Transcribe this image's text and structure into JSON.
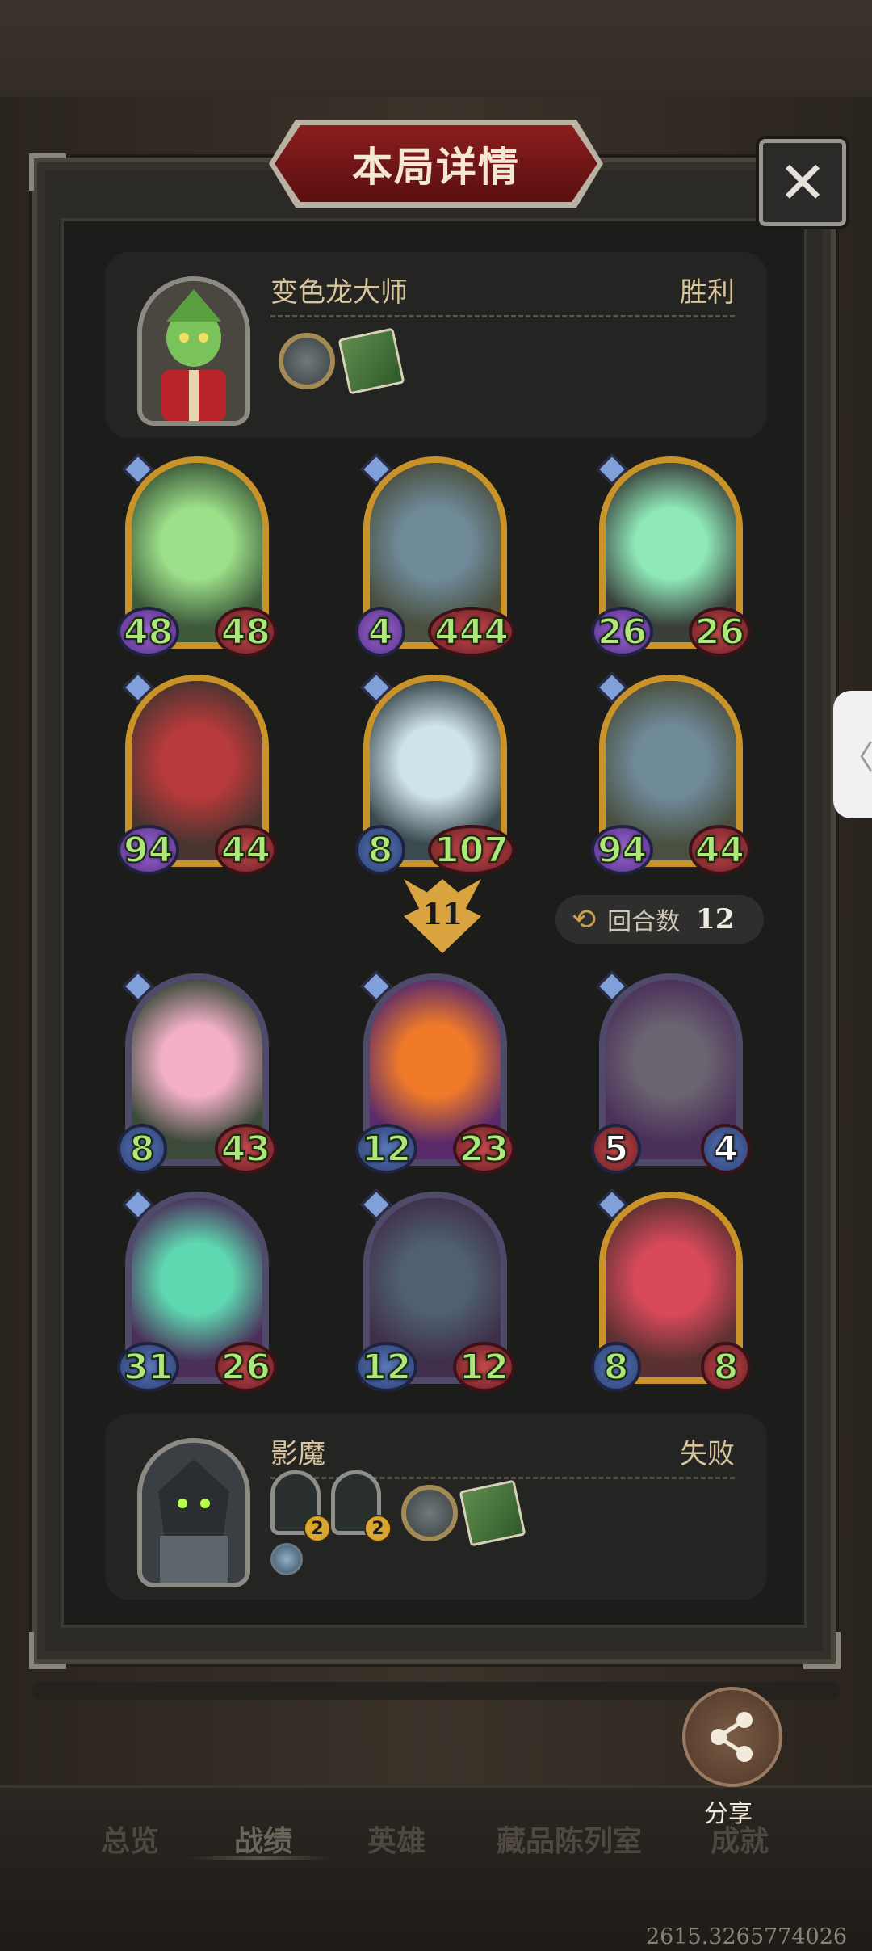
{
  "title": "本局详情",
  "close_label": "✕",
  "side_tab_glyph": "〈",
  "player1": {
    "name": "变色龙大师",
    "result": "胜利",
    "items": [
      "coin-relic",
      "green-book"
    ]
  },
  "player2": {
    "name": "影魔",
    "result": "失败",
    "items": [
      "hero-card-1",
      "hero-card-2",
      "coin-relic",
      "green-book",
      "blue-emblem"
    ],
    "stack_counts": [
      "2",
      "2"
    ]
  },
  "player1_board": [
    {
      "atk": "48",
      "hp": "48",
      "atk_type": "poison",
      "frame": "gold",
      "art": "green-sword-spirit"
    },
    {
      "atk": "4",
      "hp": "444",
      "atk_type": "poison",
      "frame": "gold",
      "art": "hat-goblin"
    },
    {
      "atk": "26",
      "hp": "26",
      "atk_type": "poison",
      "frame": "gold",
      "art": "ghost-cat"
    },
    {
      "atk": "94",
      "hp": "44",
      "atk_type": "poison",
      "frame": "gold",
      "art": "red-ogre"
    },
    {
      "atk": "8",
      "hp": "107",
      "atk_type": "normal",
      "frame": "gold",
      "art": "moth-yeti"
    },
    {
      "atk": "94",
      "hp": "44",
      "atk_type": "poison",
      "frame": "gold",
      "art": "hat-goblin"
    }
  ],
  "turn_badge": "11",
  "round": {
    "label": "回合数",
    "value": "12"
  },
  "player2_board": [
    {
      "atk": "8",
      "hp": "43",
      "atk_type": "normal",
      "frame": "purple",
      "art": "flower-fairy"
    },
    {
      "atk": "12",
      "hp": "23",
      "atk_type": "normal",
      "frame": "purple",
      "art": "fire-spirit"
    },
    {
      "atk": "5",
      "hp": "4",
      "atk_type": "red",
      "frame": "purple",
      "art": "hooded-rogue"
    },
    {
      "atk": "31",
      "hp": "26",
      "atk_type": "normal",
      "frame": "purple",
      "art": "green-genie"
    },
    {
      "atk": "12",
      "hp": "12",
      "atk_type": "normal",
      "frame": "purple",
      "art": "mushroom-bug"
    },
    {
      "atk": "8",
      "hp": "8",
      "atk_type": "normal",
      "frame": "gold",
      "art": "mushroom-girl"
    }
  ],
  "share_label": "分享",
  "nav": [
    "总览",
    "战绩",
    "英雄",
    "藏品陈列室",
    "成就"
  ],
  "nav_active": "战绩",
  "coords_text": "2615.3265774026",
  "colors": {
    "gold": "#c9932a",
    "purple": "#4f4a6a",
    "stat_text": "#aee87a",
    "banner": "#8a1d1d"
  }
}
